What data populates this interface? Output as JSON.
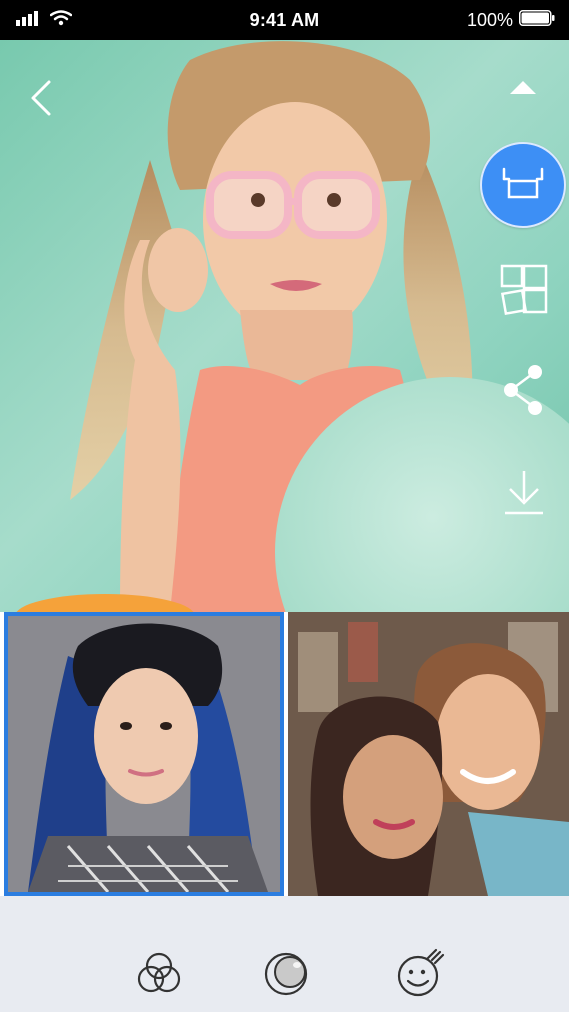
{
  "status_bar": {
    "time": "9:41 AM",
    "battery": "100%",
    "icons": [
      "signal-icon",
      "wifi-icon",
      "battery-icon"
    ]
  },
  "main_photo": {
    "subject": "photo"
  },
  "controls": {
    "back": "back-chevron-icon",
    "collapse": "caret-up-icon",
    "print": "print-icon",
    "tile": "tile-layout-icon",
    "share": "share-icon",
    "download": "download-icon"
  },
  "thumbnails": [
    {
      "selected": true
    },
    {
      "selected": false
    }
  ],
  "toolbar": {
    "items": [
      "filters-icon",
      "adjust-icon",
      "stickers-icon"
    ]
  },
  "colors": {
    "accent": "#3d8ff5",
    "selection_border": "#2b7de0",
    "toolbar_bg": "#e8ebf1",
    "icon_stroke": "#333333"
  }
}
